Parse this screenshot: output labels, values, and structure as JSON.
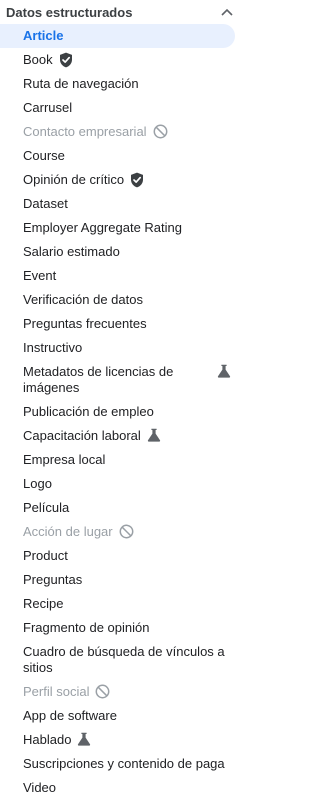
{
  "section": {
    "title": "Datos estructurados",
    "collapse_icon": "chevron-up-icon"
  },
  "items": [
    {
      "label": "Article",
      "state": "active"
    },
    {
      "label": "Book",
      "icon": "verified-shield-icon"
    },
    {
      "label": "Ruta de navegación"
    },
    {
      "label": "Carrusel"
    },
    {
      "label": "Contacto empresarial",
      "state": "disabled",
      "icon": "not-allowed-icon"
    },
    {
      "label": "Course"
    },
    {
      "label": "Opinión de crítico",
      "icon": "verified-shield-icon"
    },
    {
      "label": "Dataset"
    },
    {
      "label": "Employer Aggregate Rating"
    },
    {
      "label": "Salario estimado"
    },
    {
      "label": "Event"
    },
    {
      "label": "Verificación de datos"
    },
    {
      "label": "Preguntas frecuentes"
    },
    {
      "label": "Instructivo"
    },
    {
      "label": "Metadatos de licencias de imágenes",
      "icon": "beta-flask-icon"
    },
    {
      "label": "Publicación de empleo"
    },
    {
      "label": "Capacitación laboral",
      "icon": "beta-flask-icon"
    },
    {
      "label": "Empresa local"
    },
    {
      "label": "Logo"
    },
    {
      "label": "Película"
    },
    {
      "label": "Acción de lugar",
      "state": "disabled",
      "icon": "not-allowed-icon"
    },
    {
      "label": "Product"
    },
    {
      "label": "Preguntas"
    },
    {
      "label": "Recipe"
    },
    {
      "label": "Fragmento de opinión"
    },
    {
      "label": "Cuadro de búsqueda de vínculos a sitios"
    },
    {
      "label": "Perfil social",
      "state": "disabled",
      "icon": "not-allowed-icon"
    },
    {
      "label": "App de software"
    },
    {
      "label": "Hablado",
      "icon": "beta-flask-icon"
    },
    {
      "label": "Suscripciones y contenido de paga"
    },
    {
      "label": "Video"
    }
  ],
  "colors": {
    "active_bg": "#e8f0fe",
    "active_text": "#1a73e8",
    "disabled_text": "#9aa0a6",
    "icon_dark": "#3c4043"
  }
}
